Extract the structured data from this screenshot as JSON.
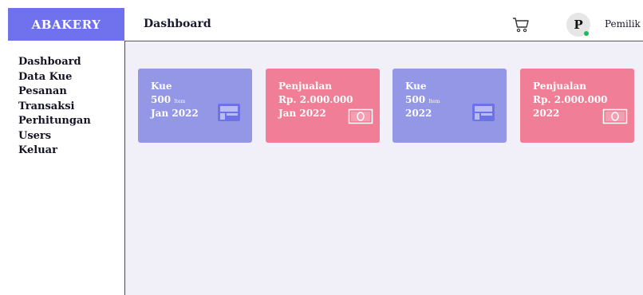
{
  "brand": {
    "name": "ABAKERY",
    "color": "#6f72ec"
  },
  "header": {
    "title": "Dashboard",
    "user": {
      "initial": "P",
      "name": "Pemilik",
      "status_color": "#1fb957"
    }
  },
  "sidebar": {
    "items": [
      {
        "label": "Dashboard"
      },
      {
        "label": "Data Kue"
      },
      {
        "label": "Pesanan"
      },
      {
        "label": "Transaksi"
      },
      {
        "label": "Perhitungan"
      },
      {
        "label": "Users"
      },
      {
        "label": "Keluar"
      }
    ]
  },
  "cards": [
    {
      "title": "Kue",
      "value": "500",
      "unit": "Item",
      "period": "Jan 2022",
      "icon": "box-icon",
      "color": "#9397e6"
    },
    {
      "title": "Penjualan",
      "value": "Rp. 2.000.000",
      "unit": "",
      "period": "Jan 2022",
      "icon": "money-icon",
      "color": "#f17e97"
    },
    {
      "title": "Kue",
      "value": "500",
      "unit": "Item",
      "period": "2022",
      "icon": "box-icon",
      "color": "#9397e6"
    },
    {
      "title": "Penjualan",
      "value": "Rp. 2.000.000",
      "unit": "",
      "period": "2022",
      "icon": "money-icon",
      "color": "#f17e97"
    }
  ]
}
